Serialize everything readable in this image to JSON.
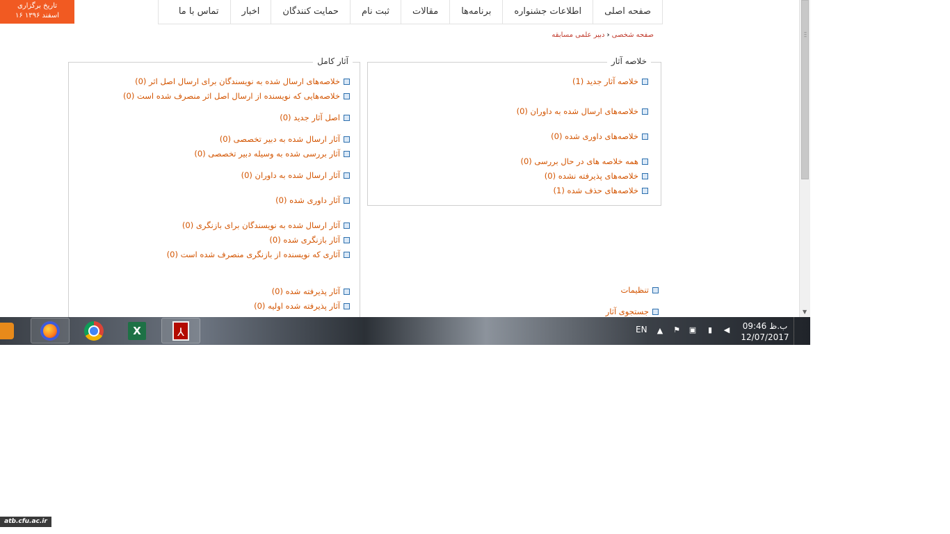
{
  "date_badge": {
    "line1": "تاریخ برگزاری",
    "line2": "۱۶ اسفند ۱۳۹۶"
  },
  "nav": {
    "items": [
      "صفحه اصلی",
      "اطلاعات جشنواره",
      "برنامه‌ها",
      "مقالات",
      "ثبت نام",
      "حمایت کنندگان",
      "اخبار",
      "تماس با ما"
    ]
  },
  "breadcrumb": {
    "home": "صفحه شخصی",
    "current": "دبیر علمی مسابقه"
  },
  "summary_box": {
    "legend": "خلاصه آثار",
    "links": [
      "خلاصه آثار جدید (1)",
      "خلاصه‌های ارسال شده به داوران (0)",
      "خلاصه‌های داوری شده (0)",
      "همه خلاصه های در حال بررسی (0)",
      "خلاصه‌های پذیرفته نشده (0)",
      "خلاصه‌های حذف شده (1)"
    ]
  },
  "full_box": {
    "legend": "آثار کامل",
    "links": [
      "خلاصه‌های ارسال شده به نویسندگان برای ارسال اصل اثر (0)",
      "خلاصه‌هایی که نویسنده از ارسال اصل اثر منصرف شده است (0)",
      "اصل آثار جدید (0)",
      "آثار ارسال شده به دبیر تخصصی (0)",
      "آثار بررسی شده به وسیله دبیر تخصصی (0)",
      "آثار ارسال شده به داوران (0)",
      "آثار داوری شده (0)",
      "آثار ارسال شده به نویسندگان برای بازنگری (0)",
      "آثار بازنگری شده (0)",
      "آثاری که نویسنده از بازنگری منصرف شده است (0)",
      "آثار پذیرفته شده (0)",
      "آثار پذیرفته شده اولیه (0)"
    ]
  },
  "side_links": {
    "settings": "تنظیمات",
    "search": "جستجوی آثار"
  },
  "taskbar": {
    "apps": [
      "media-player",
      "firefox",
      "chrome",
      "excel",
      "acrobat"
    ],
    "language": "EN",
    "time": "09:46 ب.ظ",
    "date": "12/07/2017"
  },
  "watermark": "atb.cfu.ac.ir",
  "colors": {
    "accent": "#f15a22",
    "link": "#d35400"
  }
}
